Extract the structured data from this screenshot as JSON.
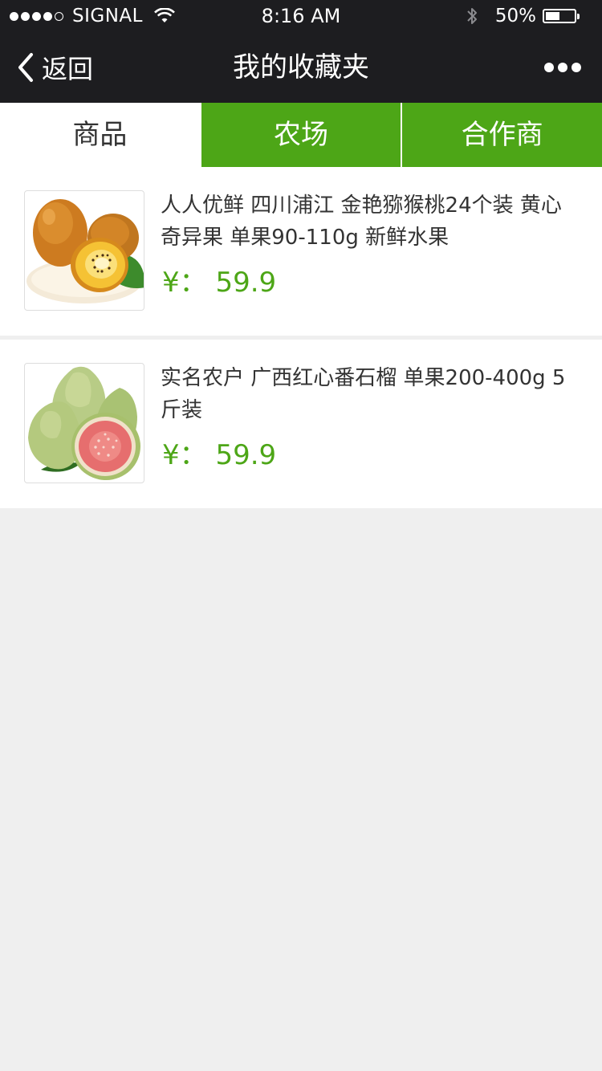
{
  "status_bar": {
    "carrier": "SIGNAL",
    "time": "8:16 AM",
    "battery_percent": "50%",
    "battery_level": 0.5,
    "signal_bars_filled": 4,
    "signal_bars_total": 5
  },
  "navbar": {
    "back_label": "返回",
    "title": "我的收藏夹"
  },
  "tabs": [
    {
      "label": "商品",
      "active": true
    },
    {
      "label": "农场",
      "active": false
    },
    {
      "label": "合作商",
      "active": false
    }
  ],
  "items": [
    {
      "title": "人人优鲜 四川浦江 金艳猕猴桃24个装 黄心奇异果 单果90-110g 新鲜水果",
      "price": "¥： 59.9",
      "image": "kiwi-fruit-image"
    },
    {
      "title": "实名农户 广西红心番石榴 单果200-400g 5斤装",
      "price": "¥： 59.9",
      "image": "guava-fruit-image"
    }
  ],
  "colors": {
    "accent_green": "#4da617",
    "bar_dark": "#1d1d20",
    "background": "#efefef"
  }
}
